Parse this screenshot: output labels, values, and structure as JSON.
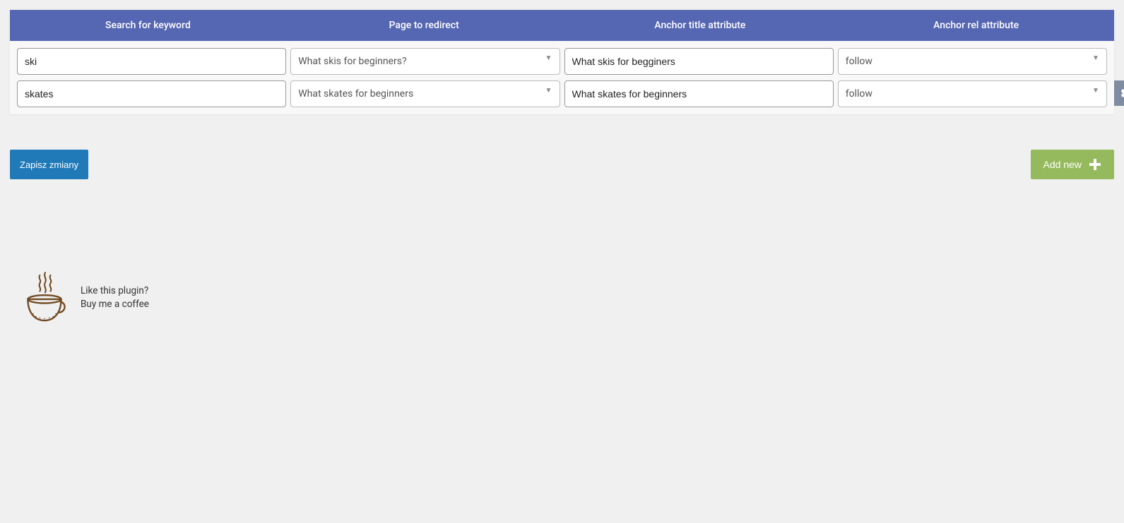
{
  "headers": {
    "keyword": "Search for keyword",
    "redirect": "Page to redirect",
    "title_attr": "Anchor title attribute",
    "rel_attr": "Anchor rel attribute"
  },
  "rows": [
    {
      "keyword": "ski",
      "redirect": "What skis for beginners?",
      "title_attr": "What skis for begginers",
      "rel_attr": "follow",
      "show_close": false
    },
    {
      "keyword": "skates",
      "redirect": "What skates for beginners",
      "title_attr": "What skates for beginners",
      "rel_attr": "follow",
      "show_close": true
    }
  ],
  "buttons": {
    "save": "Zapisz zmiany",
    "add": "Add new"
  },
  "promo": {
    "line1": "Like this plugin?",
    "line2": "Buy me a coffee"
  }
}
